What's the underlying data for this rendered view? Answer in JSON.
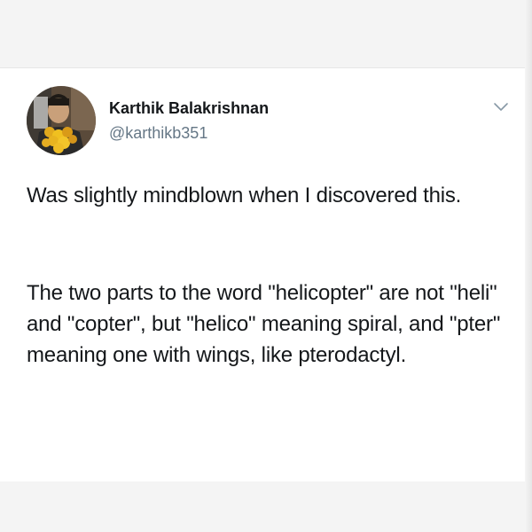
{
  "tweet": {
    "author": {
      "display_name": "Karthik Balakrishnan",
      "handle": "@karthikb351"
    },
    "paragraphs": [
      "Was slightly mindblown when I discovered this.",
      "The two parts to the word \"helicopter\" are not \"heli\" and \"copter\", but \"helico\" meaning spiral, and \"pter\" meaning one with wings, like pterodactyl."
    ],
    "menu_icon": "chevron-down-icon"
  },
  "colors": {
    "text": "#14171a",
    "handle": "#657786",
    "background": "#f2f2f2",
    "card": "#ffffff"
  }
}
